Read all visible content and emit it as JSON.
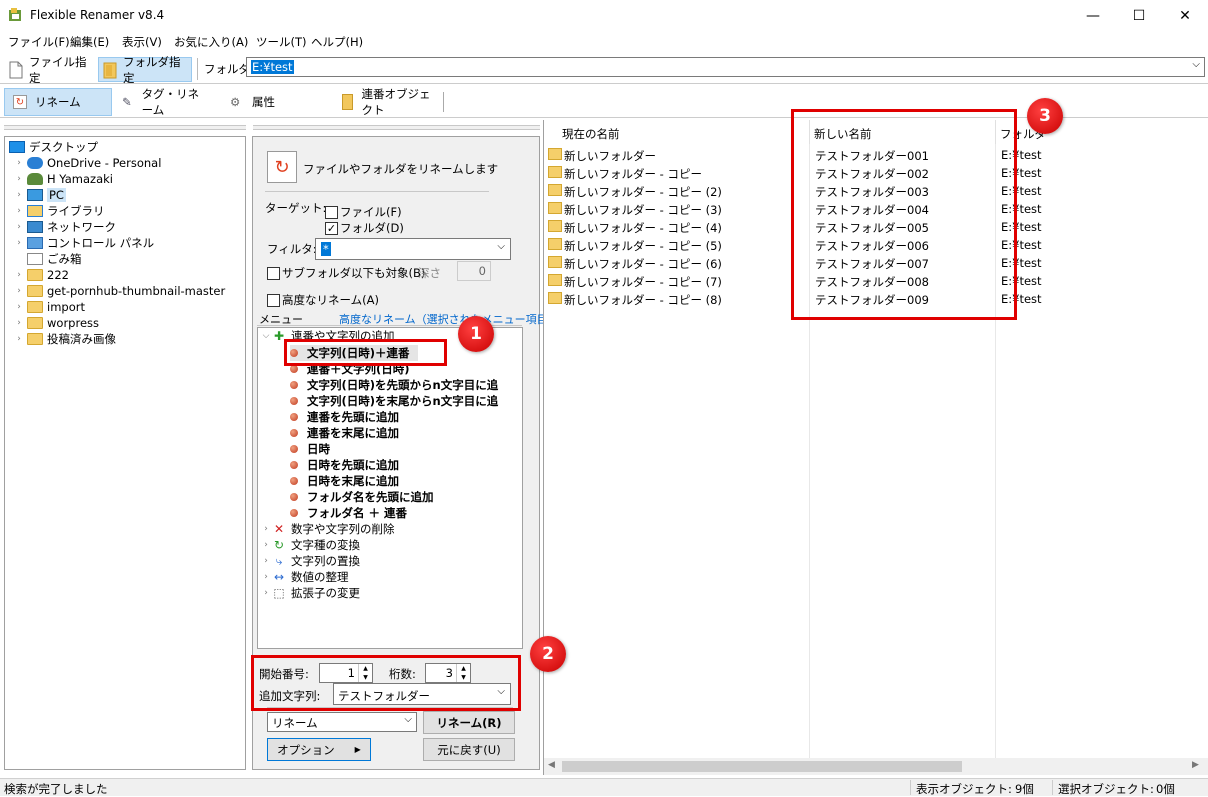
{
  "window": {
    "title": "Flexible Renamer v8.4",
    "minimize": "—",
    "maximize": "☐",
    "close": "✕"
  },
  "menubar": [
    "ファイル(F)",
    "編集(E)",
    "表示(V)",
    "お気に入り(A)",
    "ツール(T)",
    "ヘルプ(H)"
  ],
  "toolbar": {
    "file_mode": "ファイル指定",
    "folder_mode": "フォルダ指定",
    "folder_label": "フォルダ",
    "folder_value": "E:¥test"
  },
  "tabs": [
    "リネーム",
    "タグ・リネーム",
    "属性",
    "連番オブジェクト"
  ],
  "tree": [
    {
      "label": "デスクトップ",
      "icon": "desktop-icon"
    },
    {
      "label": "OneDrive - Personal",
      "icon": "cloud-icon"
    },
    {
      "label": "H Yamazaki",
      "icon": "user-icon"
    },
    {
      "label": "PC",
      "icon": "pc-icon"
    },
    {
      "label": "ライブラリ",
      "icon": "library-icon"
    },
    {
      "label": "ネットワーク",
      "icon": "network-icon"
    },
    {
      "label": "コントロール パネル",
      "icon": "control-panel-icon"
    },
    {
      "label": "ごみ箱",
      "icon": "recycle-bin-icon"
    },
    {
      "label": "222",
      "icon": "folder-icon"
    },
    {
      "label": "get-pornhub-thumbnail-master",
      "icon": "folder-icon"
    },
    {
      "label": "import",
      "icon": "folder-icon"
    },
    {
      "label": "worpress",
      "icon": "folder-icon"
    },
    {
      "label": "投稿済み画像",
      "icon": "folder-icon"
    }
  ],
  "options": {
    "header": "ファイルやフォルダをリネームします",
    "target_label": "ターゲット:",
    "file_check": "ファイル(F)",
    "folder_check": "フォルダ(D)",
    "filter_label": "フィルタ:",
    "filter_value": "*",
    "subfolder": "サブフォルダ以下も対象(B)",
    "depth_label": "深さ",
    "depth_value": "0",
    "advanced": "高度なリネーム(A)",
    "menu_label": "メニュー",
    "menu_link": "高度なリネーム（選択されたメニュー項目）"
  },
  "menu": {
    "group": "連番や文字列の追加",
    "items": [
      "文字列(日時)＋連番",
      "連番＋文字列(日時)",
      "文字列(日時)を先頭からn文字目に追",
      "文字列(日時)を末尾からn文字目に追",
      "連番を先頭に追加",
      "連番を末尾に追加",
      "日時",
      "日時を先頭に追加",
      "日時を末尾に追加",
      "フォルダ名を先頭に追加",
      "フォルダ名 ＋ 連番"
    ],
    "categories": [
      {
        "label": "数字や文字列の削除",
        "icon": "delete-icon"
      },
      {
        "label": "文字種の変換",
        "icon": "convert-icon"
      },
      {
        "label": "文字列の置換",
        "icon": "replace-icon"
      },
      {
        "label": "数値の整理",
        "icon": "number-icon"
      },
      {
        "label": "拡張子の変更",
        "icon": "extension-icon"
      }
    ]
  },
  "params": {
    "start_label": "開始番号:",
    "start_value": "1",
    "digits_label": "桁数:",
    "digits_value": "3",
    "append_label": "追加文字列:",
    "append_value": "テストフォルダー"
  },
  "actions": {
    "mode": "リネーム",
    "rename": "リネーム(R)",
    "options": "オプション",
    "undo": "元に戻す(U)"
  },
  "list": {
    "columns": [
      "現在の名前",
      "新しい名前",
      "フォルダ"
    ],
    "rows": [
      [
        "新しいフォルダー",
        "テストフォルダー001",
        "E:¥test"
      ],
      [
        "新しいフォルダー - コピー",
        "テストフォルダー002",
        "E:¥test"
      ],
      [
        "新しいフォルダー - コピー (2)",
        "テストフォルダー003",
        "E:¥test"
      ],
      [
        "新しいフォルダー - コピー (3)",
        "テストフォルダー004",
        "E:¥test"
      ],
      [
        "新しいフォルダー - コピー (4)",
        "テストフォルダー005",
        "E:¥test"
      ],
      [
        "新しいフォルダー - コピー (5)",
        "テストフォルダー006",
        "E:¥test"
      ],
      [
        "新しいフォルダー - コピー (6)",
        "テストフォルダー007",
        "E:¥test"
      ],
      [
        "新しいフォルダー - コピー (7)",
        "テストフォルダー008",
        "E:¥test"
      ],
      [
        "新しいフォルダー - コピー (8)",
        "テストフォルダー009",
        "E:¥test"
      ]
    ]
  },
  "badges": [
    "1",
    "2",
    "3"
  ],
  "status": {
    "message": "検索が完了しました",
    "shown_label": "表示オブジェクト:",
    "shown_value": "9個",
    "selected_label": "選択オブジェクト:",
    "selected_value": "0個"
  }
}
